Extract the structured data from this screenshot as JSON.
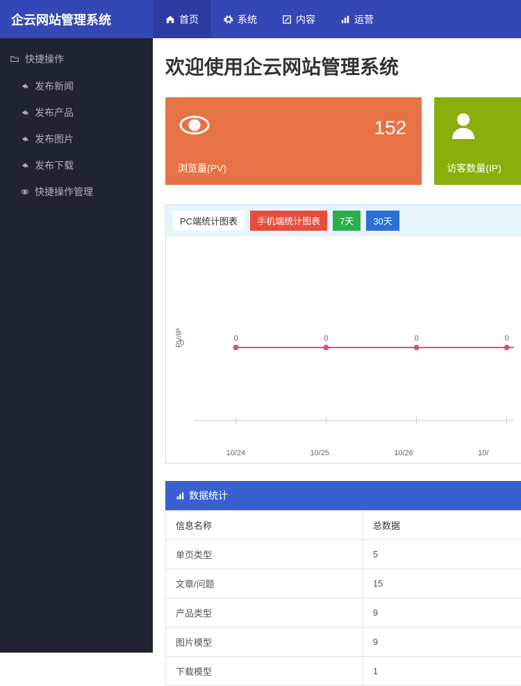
{
  "brand": "企云网站管理系统",
  "topnav": [
    {
      "label": "首页",
      "icon": "home",
      "active": true
    },
    {
      "label": "系统",
      "icon": "cog",
      "active": false
    },
    {
      "label": "内容",
      "icon": "edit",
      "active": false
    },
    {
      "label": "运营",
      "icon": "chart",
      "active": false
    }
  ],
  "sidebar": {
    "group": "快捷操作",
    "items": [
      {
        "label": "发布新闻"
      },
      {
        "label": "发布产品"
      },
      {
        "label": "发布图片"
      },
      {
        "label": "发布下载"
      },
      {
        "label": "快捷操作管理",
        "icon": "eye"
      }
    ]
  },
  "page_title": "欢迎使用企云网站管理系统",
  "cards": {
    "pv": {
      "value": "152",
      "label": "浏览量(PV)"
    },
    "ip": {
      "label": "访客数量(IP)"
    }
  },
  "chart_tabs": {
    "pc": "PC端统计图表",
    "mobile": "手机端统计图表",
    "d7": "7天",
    "d30": "30天"
  },
  "chart_data": {
    "type": "line",
    "ylabel": "PV/IP",
    "ytick": "0",
    "categories": [
      "10/24",
      "10/25",
      "10/26",
      "10/"
    ],
    "series": [
      {
        "name": "PV",
        "values": [
          0,
          0,
          0,
          0
        ]
      }
    ],
    "point_labels": [
      "0",
      "0",
      "0",
      "0"
    ]
  },
  "stats": {
    "title": "数据统计",
    "columns": [
      "信息名称",
      "总数据"
    ],
    "rows": [
      {
        "name": "单页类型",
        "value": "5"
      },
      {
        "name": "文章/问题",
        "value": "15"
      },
      {
        "name": "产品类型",
        "value": "9"
      },
      {
        "name": "图片模型",
        "value": "9"
      },
      {
        "name": "下载模型",
        "value": "1"
      }
    ]
  }
}
